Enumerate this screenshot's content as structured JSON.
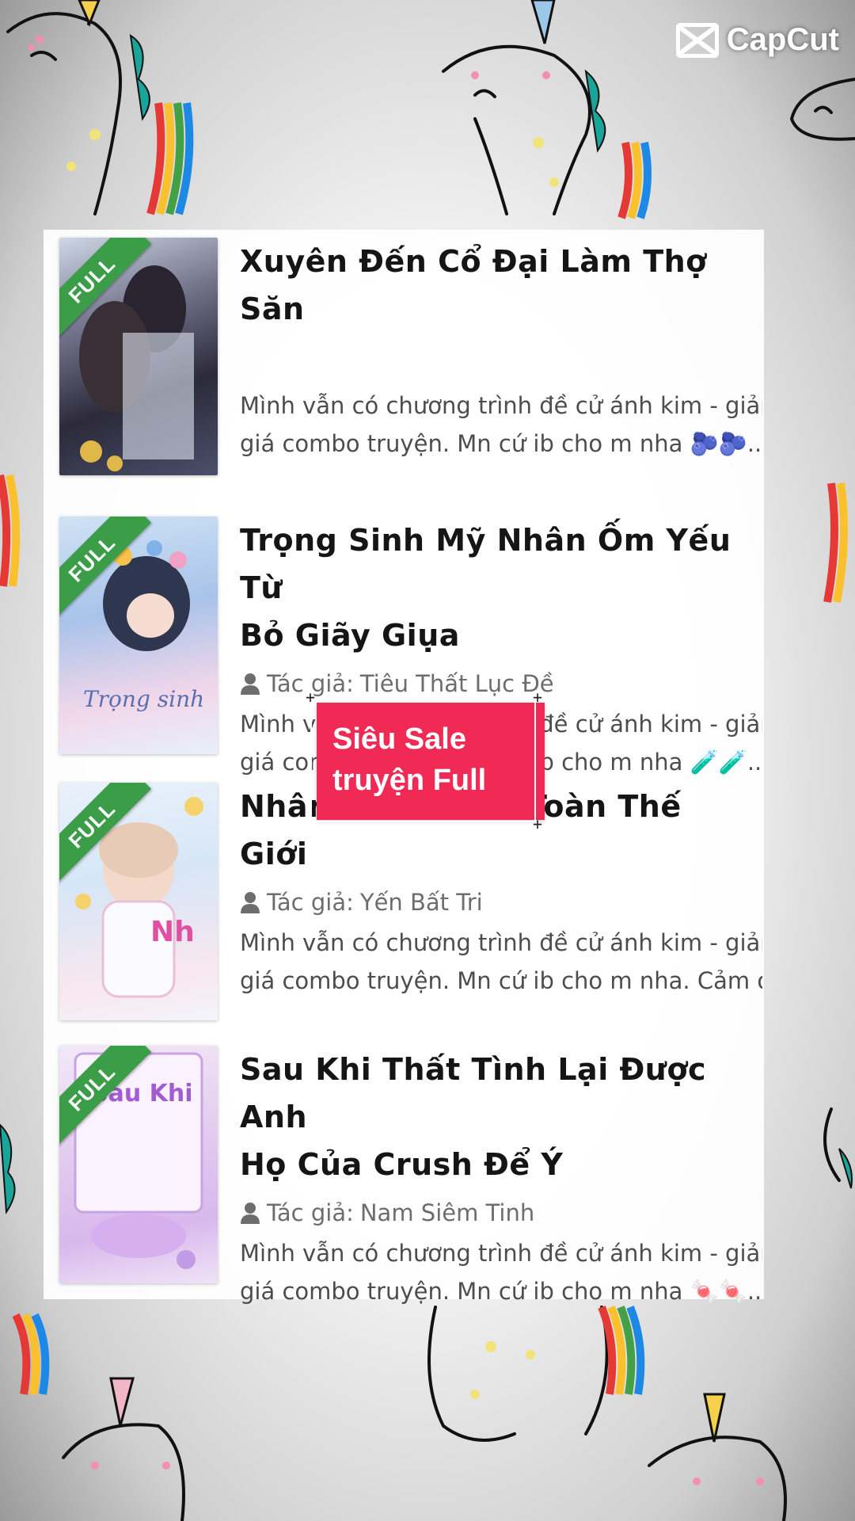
{
  "brand": {
    "name": "CapCut"
  },
  "books": [
    {
      "title_lines": [
        "Xuyên Đến Cổ Đại Làm Thợ Săn",
        ""
      ],
      "ribbon": "FULL",
      "author_label": "",
      "author": "",
      "desc_lines": [
        "Mình vẫn có chương trình đề cử ánh kim - giảm",
        "giá combo truyện. Mn cứ ib cho m nha 🫐🫐..."
      ]
    },
    {
      "title_lines": [
        "Trọng Sinh Mỹ Nhân Ốm Yếu Từ",
        "Bỏ Giãy Giụa"
      ],
      "ribbon": "FULL",
      "author_label": "Tác giả:",
      "author": "Tiêu Thất Lục Đề",
      "desc_lines": [
        "Mình vẫn có chương trình đề cử ánh kim - giảm",
        "giá combo truyện. Mn cứ ib cho m nha 🧪🧪..."
      ]
    },
    {
      "title_lines": [
        "Nhân Ma Giáo... Toàn Thế",
        "Giới"
      ],
      "ribbon": "FULL",
      "author_label": "Tác giả:",
      "author": "Yến Bất Tri",
      "desc_lines": [
        "Mình vẫn có chương trình đề cử ánh kim - giảm",
        "giá combo truyện. Mn cứ ib cho m nha. Cảm ơ..."
      ]
    },
    {
      "title_lines": [
        "Sau Khi Thất Tình Lại Được Anh",
        "Họ Của Crush Để Ý"
      ],
      "ribbon": "FULL",
      "author_label": "Tác giả:",
      "author": "Nam Siêm Tinh",
      "desc_lines": [
        "Mình vẫn có chương trình đề cử ánh kim - giảm",
        "giá combo truyện. Mn cứ ib cho m nha 🍬🍬..."
      ]
    }
  ],
  "sticker": {
    "line1": "Siêu Sale",
    "line2": "truyện Full"
  },
  "colors": {
    "ribbon": "#3c9d48",
    "sticker": "#f12a55",
    "title": "#151515",
    "meta": "#6d6d6d"
  }
}
